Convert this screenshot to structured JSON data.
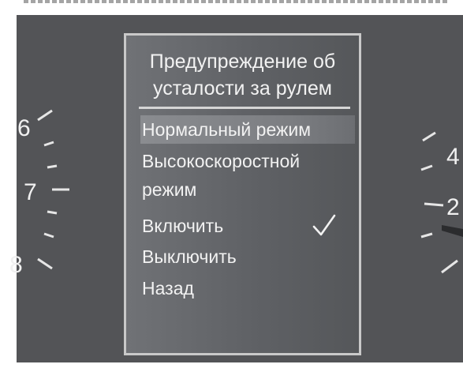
{
  "menu": {
    "title_line1": "Предупреждение об",
    "title_line2": "усталости за рулем",
    "items": [
      {
        "label": "Нормальный режим",
        "selected": true
      },
      {
        "label": "Высокоскоростной",
        "label_line2": "режим",
        "selected": false
      },
      {
        "label": "Включить",
        "selected": false,
        "checked": true
      },
      {
        "label": "Выключить",
        "selected": false
      },
      {
        "label": "Назад",
        "selected": false
      }
    ]
  },
  "left_gauge": {
    "tick_labels": [
      "6",
      "7",
      "8"
    ]
  },
  "right_gauge": {
    "tick_labels": [
      "4",
      "2"
    ]
  },
  "icons": {
    "checkmark": "checkmark-icon"
  }
}
